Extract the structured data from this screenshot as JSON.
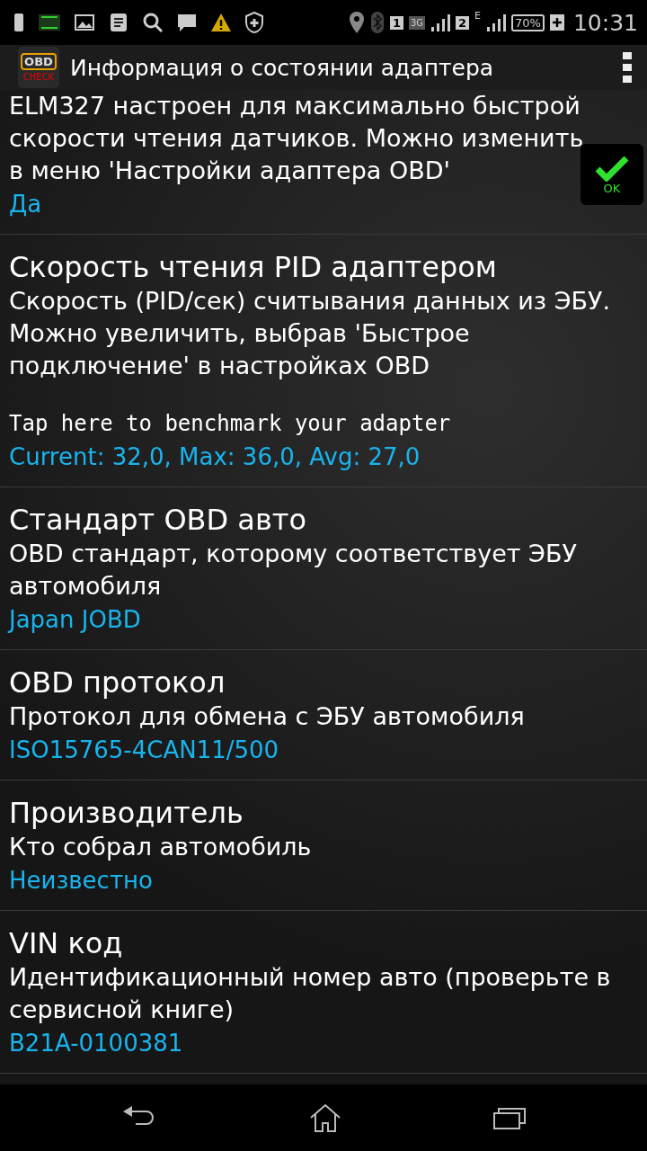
{
  "status_bar": {
    "sim1": "1",
    "network1": "3G",
    "sim2": "2",
    "network2": "E",
    "battery": "70%",
    "time": "10:31"
  },
  "action_bar": {
    "title": "Информация о состоянии адаптера",
    "logo_top": "OBD",
    "logo_bottom": "CHECK"
  },
  "items": [
    {
      "description": "ELM327 настроен для максимально быстрой скорости чтения датчиков. Можно изменить в меню 'Настройки адаптера OBD'",
      "value": "Да",
      "badge": "OK"
    },
    {
      "title": "Скорость чтения PID адаптером",
      "description": "Скорость (PID/сек) считывания данных из ЭБУ. Можно увеличить, выбрав 'Быстрое подключение' в настройках OBD",
      "action": "Tap here to benchmark your adapter",
      "value": "Current: 32,0, Max: 36,0, Avg: 27,0"
    },
    {
      "title": "Стандарт OBD авто",
      "description": "OBD стандарт, которому соответствует ЭБУ автомобиля",
      "value": "Japan JOBD"
    },
    {
      "title": "OBD протокол",
      "description": "Протокол для обмена с ЭБУ автомобиля",
      "value": "ISO15765-4CAN11/500"
    },
    {
      "title": "Производитель",
      "description": "Кто собрал автомобиль",
      "value": "Неизвестно"
    },
    {
      "title": "VIN код",
      "description": "Идентификационный номер авто (проверьте в сервисной книге)",
      "value": "B21A-0100381"
    }
  ]
}
